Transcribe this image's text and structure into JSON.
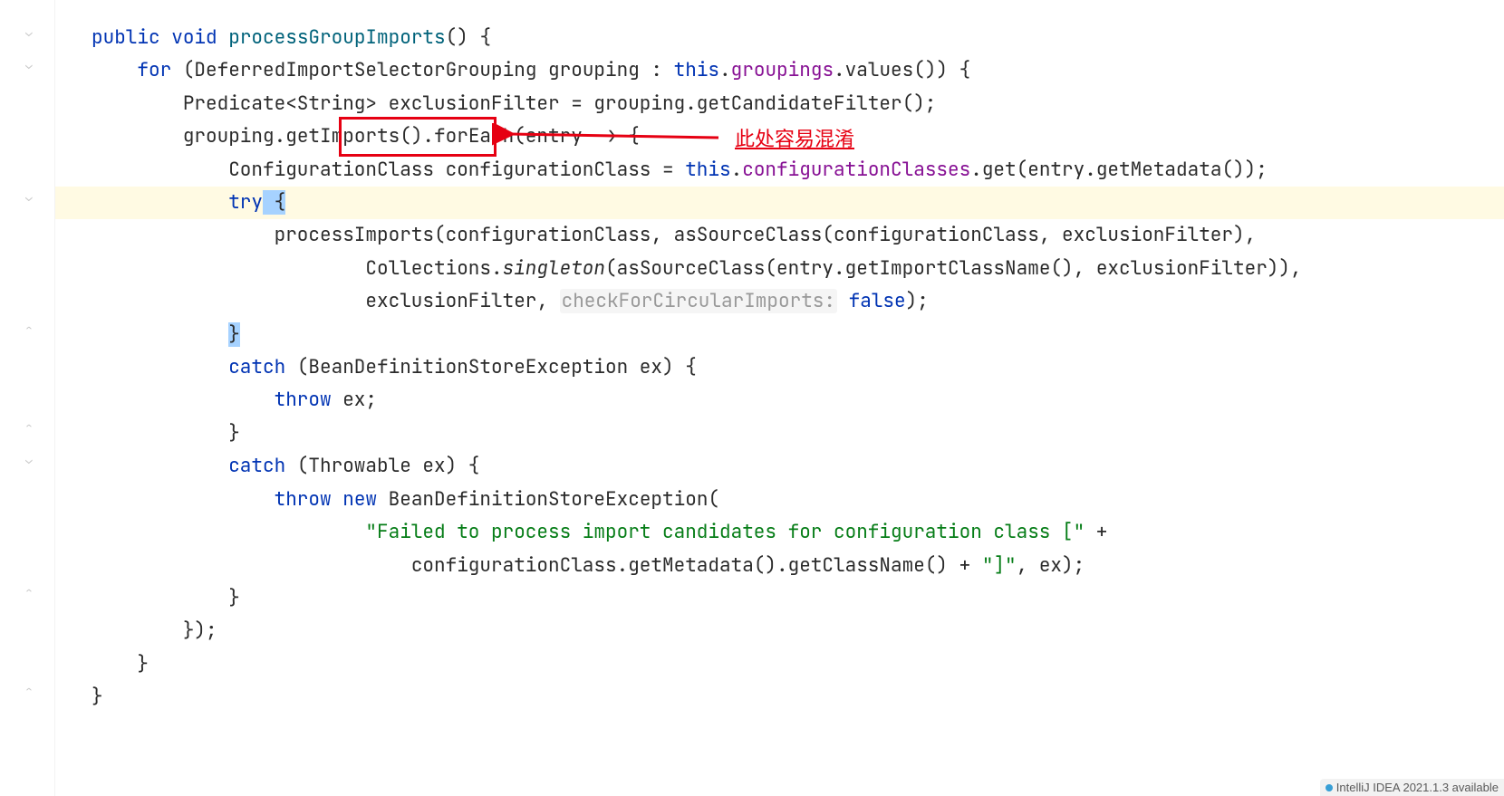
{
  "annotation": {
    "note_text": "此处容易混淆"
  },
  "status": {
    "update_text": "IntelliJ IDEA 2021.1.3 available"
  },
  "code": {
    "l1": {
      "kw_public": "public",
      "kw_void": "void",
      "method": "processGroupImports",
      "tail": "() {"
    },
    "l2": {
      "kw_for": "for",
      "pre": " (DeferredImportSelectorGrouping grouping : ",
      "kw_this": "this",
      "dot": ".",
      "fld": "groupings",
      "call": ".values()) {"
    },
    "l3": {
      "text": "Predicate<String> exclusionFilter = grouping.getCandidateFilter();"
    },
    "l4": {
      "pre": "grouping.",
      "box": "getImports()",
      "post": ".forEach(entry -> {"
    },
    "l5": {
      "pre": "ConfigurationClass configurationClass = ",
      "kw_this": "this",
      "dot": ".",
      "fld": "configurationClasses",
      "post": ".get(entry.getMetadata());"
    },
    "l6": {
      "kw_try": "try",
      "brace": " {"
    },
    "l7": {
      "text": "processImports(configurationClass, asSourceClass(configurationClass, exclusionFilter),"
    },
    "l8": {
      "pre": "Collections.",
      "ital": "singleton",
      "post": "(asSourceClass(entry.getImportClassName(), exclusionFilter)),"
    },
    "l9": {
      "pre": "exclusionFilter, ",
      "hint": "checkForCircularImports:",
      "sp": " ",
      "kw_false": "false",
      "post": ");"
    },
    "l10": {
      "brace": "}"
    },
    "l11": {
      "kw_catch": "catch",
      "post": " (BeanDefinitionStoreException ex) {"
    },
    "l12": {
      "kw_throw": "throw",
      "post": " ex;"
    },
    "l13": {
      "brace": "}"
    },
    "l14": {
      "kw_catch": "catch",
      "post": " (Throwable ex) {"
    },
    "l15": {
      "kw_throw": "throw",
      "kw_new": "new",
      "post": " BeanDefinitionStoreException("
    },
    "l16": {
      "str": "\"Failed to process import candidates for configuration class [\"",
      "post": " +"
    },
    "l17": {
      "pre": "configurationClass.getMetadata().getClassName() + ",
      "str": "\"]\"",
      "post": ", ex);"
    },
    "l18": {
      "brace": "}"
    },
    "l19": {
      "brace": "});"
    },
    "l20": {
      "brace": "}"
    },
    "l21": {
      "brace": "}"
    }
  },
  "indent": {
    "i0": "",
    "i1": "    ",
    "i2": "        ",
    "i3": "            ",
    "i4": "                ",
    "i5": "                    ",
    "i6": "                        ",
    "i7": "                            "
  }
}
